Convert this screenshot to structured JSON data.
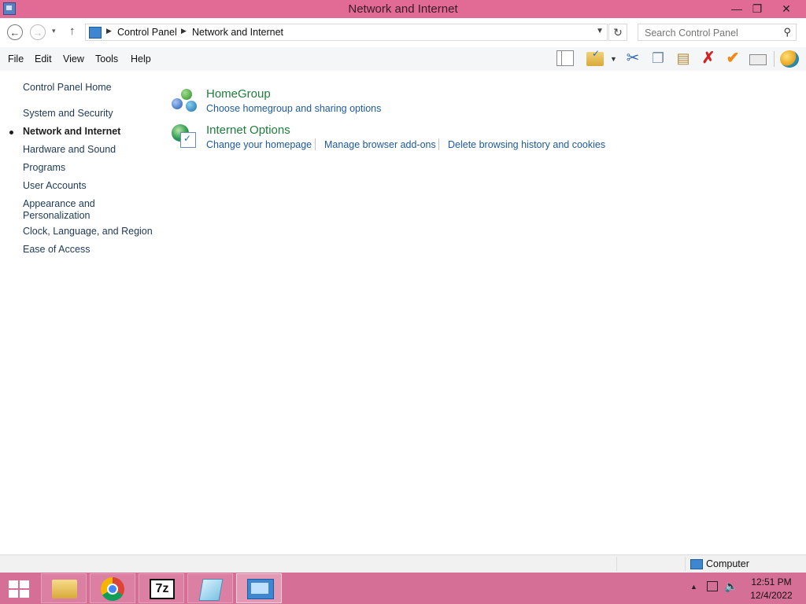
{
  "window": {
    "title": "Network and Internet"
  },
  "nav": {
    "back": "←",
    "forward": "→",
    "dropdown": "▾",
    "up": "↑"
  },
  "address": {
    "segments": [
      "Control Panel",
      "Network and Internet"
    ],
    "refresh": "↻"
  },
  "search": {
    "placeholder": "Search Control Panel",
    "icon": "search-icon"
  },
  "menu": {
    "items": [
      "File",
      "Edit",
      "View",
      "Tools",
      "Help"
    ]
  },
  "toolbar": {
    "icons": [
      "layout-icon",
      "folder-options-icon",
      "cut-icon",
      "copy-icon",
      "paste-icon",
      "delete-icon",
      "apply-icon",
      "properties-icon",
      "internet-icon"
    ]
  },
  "sidebar": {
    "home": "Control Panel Home",
    "items": [
      {
        "label": "System and Security",
        "current": false
      },
      {
        "label": "Network and Internet",
        "current": true
      },
      {
        "label": "Hardware and Sound",
        "current": false
      },
      {
        "label": "Programs",
        "current": false
      },
      {
        "label": "User Accounts",
        "current": false
      },
      {
        "label": "Appearance and Personalization",
        "current": false
      },
      {
        "label": "Clock, Language, and Region",
        "current": false
      },
      {
        "label": "Ease of Access",
        "current": false
      }
    ]
  },
  "categories": [
    {
      "title": "HomeGroup",
      "icon": "homegroup-icon",
      "links": [
        "Choose homegroup and sharing options"
      ]
    },
    {
      "title": "Internet Options",
      "icon": "internet-options-icon",
      "links": [
        "Change your homepage",
        "Manage browser add-ons",
        "Delete browsing history and cookies"
      ]
    }
  ],
  "statusbar": {
    "text": "Computer",
    "icon": "computer-icon"
  },
  "taskbar": {
    "apps": [
      "File Explorer",
      "Google Chrome",
      "7-Zip",
      "Notepad",
      "Control Panel"
    ],
    "sevenzip_label": "7z",
    "active_app": "Control Panel"
  },
  "clock": {
    "time": "12:51 PM",
    "date": "12/4/2022"
  },
  "colors": {
    "titlebar": "#e26b95",
    "taskbar": "#d66f96",
    "link": "#1d5a9c",
    "category_title": "#1e7d3b"
  }
}
